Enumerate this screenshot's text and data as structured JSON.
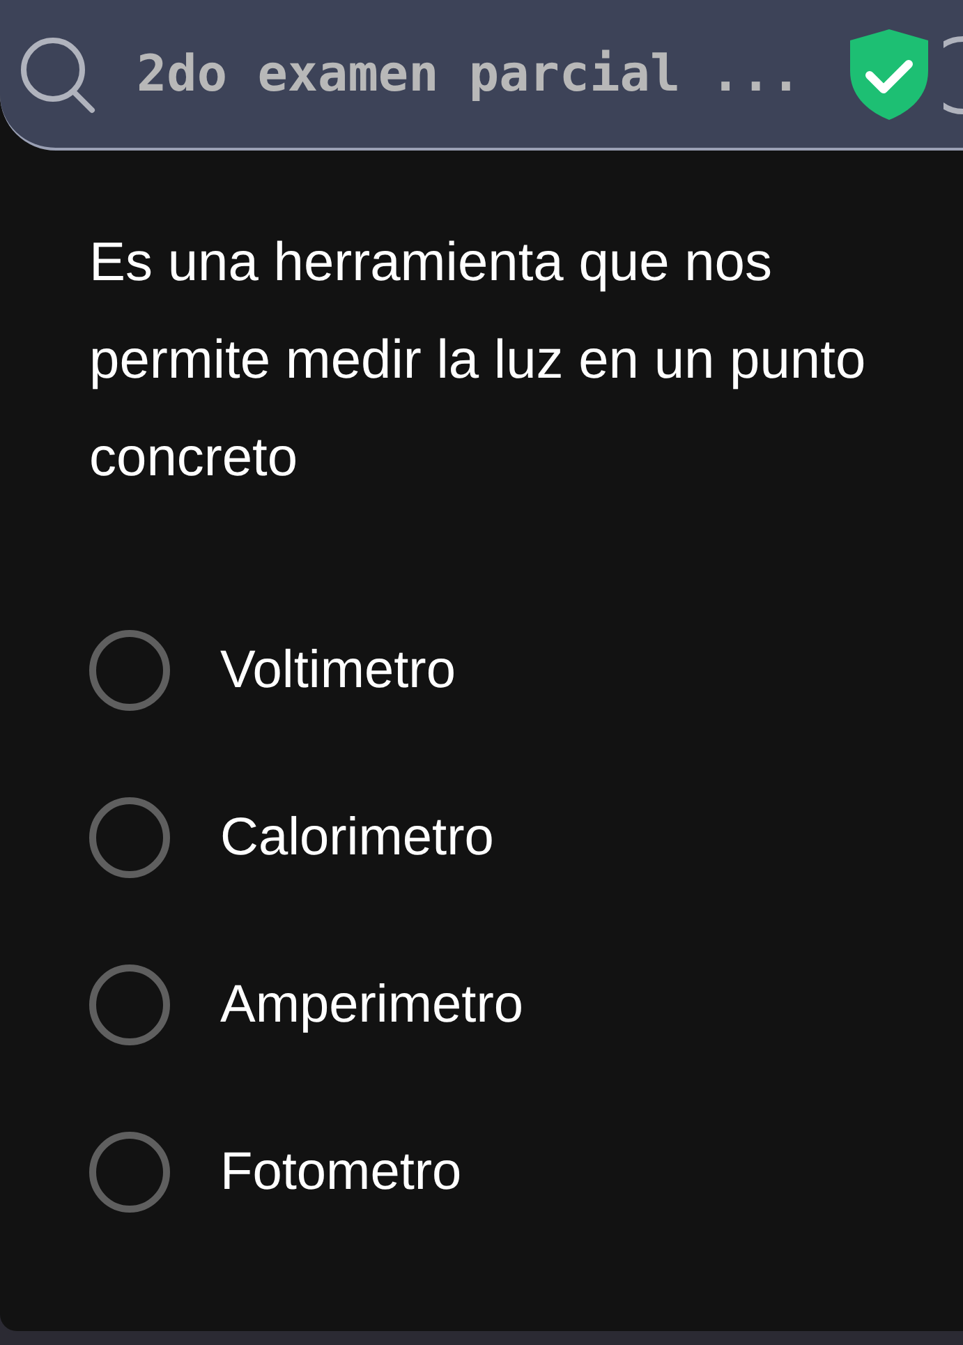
{
  "header": {
    "title": "2do examen parcial ..."
  },
  "question": {
    "text": "Es una herramienta que nos permite medir la luz en un punto concreto"
  },
  "options": [
    {
      "label": "Voltimetro",
      "selected": false
    },
    {
      "label": "Calorimetro",
      "selected": false
    },
    {
      "label": "Amperimetro",
      "selected": false
    },
    {
      "label": "Fotometro",
      "selected": false
    }
  ]
}
